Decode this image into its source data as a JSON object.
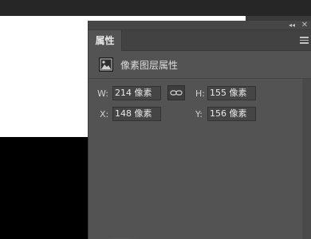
{
  "panel": {
    "tab_label": "属性",
    "collapse_glyph": "◂◂",
    "close_glyph": "✕"
  },
  "section": {
    "title": "像素图层属性"
  },
  "fields": {
    "w_label": "W:",
    "w_value": "214 像素",
    "h_label": "H:",
    "h_value": "155 像素",
    "x_label": "X:",
    "x_value": "148 像素",
    "y_label": "Y:",
    "y_value": "156 像素"
  },
  "icons": {
    "layer": "image-icon",
    "link": "chain-link-icon",
    "menu": "panel-menu-icon",
    "collapse": "collapse-icon",
    "close": "close-icon"
  },
  "colors": {
    "panel_bg": "#535353",
    "tab_bar_bg": "#424242",
    "input_bg": "#454545",
    "canvas_white": "#ffffff",
    "canvas_black": "#000000"
  }
}
